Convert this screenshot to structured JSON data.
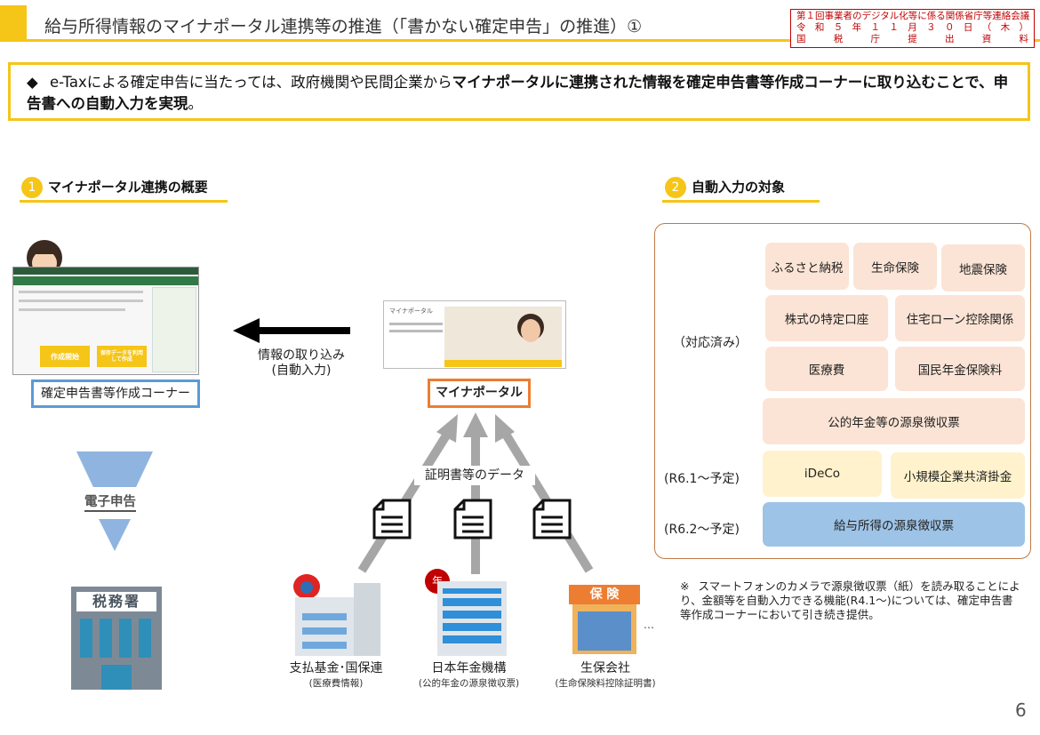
{
  "header": {
    "title": "給与所得情報のマイナポータル連携等の推進（「書かない確定申告」の推進）①",
    "stamp_lines": [
      "第１回事業者のデジタル化等に係る関係省庁等連絡会議",
      "令 和 ５ 年 １ １ 月 ３ ０ 日 （ 木 ）",
      "国 税 庁 提 出 資 料"
    ]
  },
  "summary": {
    "bullet": "◆",
    "text_plain": "e-Taxによる確定申告に当たっては、政府機関や民間企業から",
    "text_bold_1": "マイナポータルに連携された情報を確定申告書等作成コーナーに取り込むことで、",
    "text_bold_2": "申告書への自動入力を実現",
    "text_end": "。"
  },
  "section1": {
    "number": "1",
    "title": "マイナポータル連携の概要"
  },
  "section2": {
    "number": "2",
    "title": "自動入力の対象"
  },
  "left": {
    "corner_label": "確定申告書等作成コーナー",
    "e_filing": "電子申告",
    "tax_office_sign": "税務署",
    "screen_btn_1": "作成開始",
    "screen_btn_2": "保存データを利用して作成"
  },
  "center": {
    "import_label_1": "情報の取り込み",
    "import_label_2": "(自動入力)",
    "myna_label": "マイナポータル",
    "myna_screen_text": "マイナポータル",
    "cert_label": "証明書等のデータ",
    "ellipsis": "…",
    "sources": [
      {
        "name": "支払基金･国保連",
        "sub": "(医療費情報)"
      },
      {
        "name": "日本年金機構",
        "sub": "(公的年金の源泉徴収票)"
      },
      {
        "name": "生保会社",
        "sub": "(生命保険料控除証明書)"
      }
    ],
    "insurance_sign": "保 険"
  },
  "auto": {
    "row1_label": "（対応済み）",
    "row1_items": [
      "ふるさと納税",
      "生命保険",
      "地震保険",
      "株式の特定口座",
      "住宅ローン控除関係",
      "医療費",
      "国民年金保険料",
      "公的年金等の源泉徴収票"
    ],
    "row2_label": "(R6.1～予定)",
    "row2_items": [
      "iDeCo",
      "小規模企業共済掛金"
    ],
    "row3_label": "(R6.2～予定)",
    "row3_items": [
      "給与所得の源泉徴収票"
    ]
  },
  "note": {
    "mark": "※",
    "text": "スマートフォンのカメラで源泉徴収票（紙）を読み取ることにより、金額等を自動入力できる機能(R4.1～)については、確定申告書等作成コーナーにおいて引き続き提供。"
  },
  "page_number": "6",
  "colors": {
    "accent": "#f5c518",
    "blue_box": "#5b9bd5",
    "orange_box": "#ed7d31",
    "panel_border": "#c07a45",
    "arrow_gray": "#a6a6a6"
  }
}
